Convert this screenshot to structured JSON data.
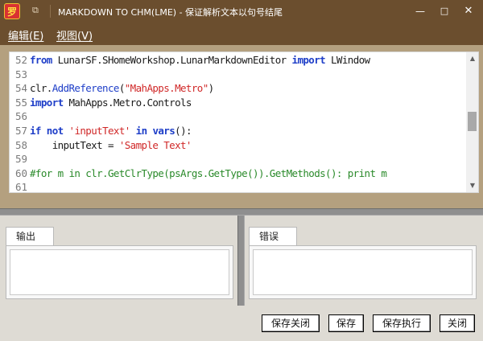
{
  "window": {
    "app_icon_glyph": "罗",
    "pin_icon": "pin-icon",
    "title": "MARKDOWN TO CHM(LME) - 保证解析文本以句号结尾",
    "controls": {
      "minimize": "—",
      "maximize": "□",
      "close": "✕"
    }
  },
  "menu": {
    "items": [
      {
        "label": "编辑(E)"
      },
      {
        "label": "视图(V)"
      }
    ]
  },
  "editor": {
    "lines": [
      {
        "num": "52",
        "tokens": [
          {
            "t": "from",
            "c": "kw"
          },
          {
            "t": " LunarSF.SHomeWorkshop.LunarMarkdownEditor ",
            "c": "pl"
          },
          {
            "t": "import",
            "c": "kw"
          },
          {
            "t": " LWindow",
            "c": "pl"
          }
        ]
      },
      {
        "num": "53",
        "tokens": []
      },
      {
        "num": "54",
        "tokens": [
          {
            "t": "clr.",
            "c": "pl"
          },
          {
            "t": "AddReference",
            "c": "fn"
          },
          {
            "t": "(",
            "c": "pl"
          },
          {
            "t": "\"MahApps.Metro\"",
            "c": "str"
          },
          {
            "t": ")",
            "c": "pl"
          }
        ]
      },
      {
        "num": "55",
        "tokens": [
          {
            "t": "import",
            "c": "kw"
          },
          {
            "t": " MahApps.Metro.Controls",
            "c": "pl"
          }
        ]
      },
      {
        "num": "56",
        "tokens": []
      },
      {
        "num": "57",
        "tokens": [
          {
            "t": "if",
            "c": "kw"
          },
          {
            "t": " ",
            "c": "pl"
          },
          {
            "t": "not",
            "c": "kw"
          },
          {
            "t": " ",
            "c": "pl"
          },
          {
            "t": "'inputText'",
            "c": "str"
          },
          {
            "t": " ",
            "c": "pl"
          },
          {
            "t": "in",
            "c": "kw"
          },
          {
            "t": " ",
            "c": "pl"
          },
          {
            "t": "vars",
            "c": "kw"
          },
          {
            "t": "():",
            "c": "pl"
          }
        ]
      },
      {
        "num": "58",
        "tokens": [
          {
            "t": "    inputText = ",
            "c": "pl"
          },
          {
            "t": "'Sample Text'",
            "c": "str"
          }
        ]
      },
      {
        "num": "59",
        "tokens": []
      },
      {
        "num": "60",
        "tokens": [
          {
            "t": "#for m in clr.GetClrType(psArgs.GetType()).GetMethods(): print m",
            "c": "cm"
          }
        ]
      },
      {
        "num": "61",
        "tokens": []
      }
    ],
    "scroll_position": 0.45
  },
  "panels": {
    "output_tab": "输出",
    "error_tab": "错误"
  },
  "buttons": {
    "save_close": "保存关闭",
    "save": "保存",
    "save_run": "保存执行",
    "close": "关闭"
  },
  "colors": {
    "titlebar": "#6b4e2e",
    "keyword": "#1e3ec8",
    "string": "#d02828",
    "comment": "#2a8a2a"
  }
}
